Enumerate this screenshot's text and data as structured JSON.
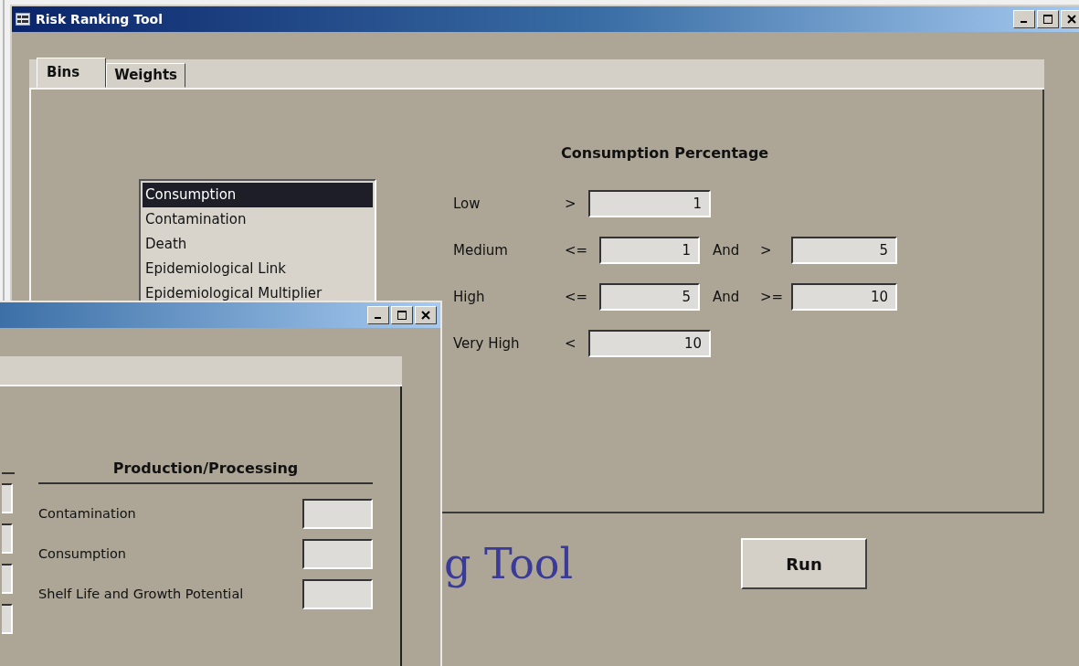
{
  "main_window": {
    "title": "Risk Ranking Tool",
    "tabs": [
      {
        "label": "Bins",
        "selected": true
      },
      {
        "label": "Weights",
        "selected": false
      }
    ],
    "list": [
      {
        "label": "Consumption",
        "selected": true
      },
      {
        "label": "Contamination",
        "selected": false
      },
      {
        "label": "Death",
        "selected": false
      },
      {
        "label": "Epidemiological Link",
        "selected": false
      },
      {
        "label": "Epidemiological Multiplier",
        "selected": false
      }
    ],
    "form": {
      "heading": "Consumption Percentage",
      "rows": [
        {
          "label": "Low",
          "op1": ">",
          "value1": "1"
        },
        {
          "label": "Medium",
          "op1": "<=",
          "value1": "1",
          "joiner": "And",
          "op2": ">",
          "value2": "5"
        },
        {
          "label": "High",
          "op1": "<=",
          "value1": "5",
          "joiner": "And",
          "op2": ">=",
          "value2": "10"
        },
        {
          "label": "Very High",
          "op1": "<",
          "value1": "10"
        }
      ]
    },
    "banner": "g Tool",
    "run_button": "Run"
  },
  "second_window": {
    "group_heading": "Production/Processing",
    "rows": [
      {
        "label": "Contamination"
      },
      {
        "label": "Consumption"
      },
      {
        "label": "Shelf Life and Growth Potential"
      }
    ]
  }
}
